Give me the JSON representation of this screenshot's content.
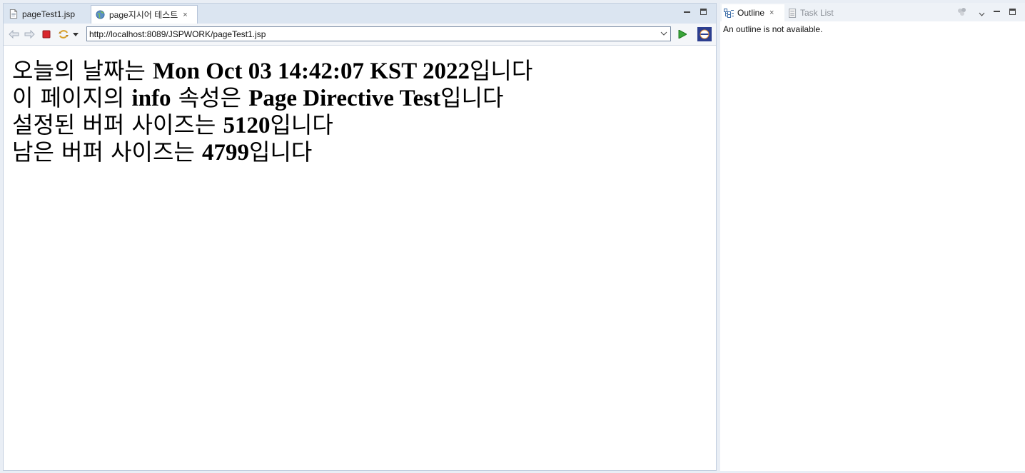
{
  "editor": {
    "tabs": [
      {
        "label": "pageTest1.jsp",
        "icon": "jsp-file-icon",
        "active": false
      },
      {
        "label": "page지시어 테스트",
        "icon": "globe-icon",
        "active": true,
        "close": "×"
      }
    ],
    "toolbar": {
      "url": "http://localhost:8089/JSPWORK/pageTest1.jsp"
    },
    "content": [
      {
        "prefix": "오늘의 날짜는 ",
        "value": "Mon Oct 03 14:42:07 KST 2022",
        "suffix": "입니다"
      },
      {
        "prefix": "이 페이지의 ",
        "value": "info",
        "middle": " 속성은 ",
        "value2": "Page Directive Test",
        "suffix": "입니다"
      },
      {
        "prefix": "설정된 버퍼 사이즈는 ",
        "value": "5120",
        "suffix": "입니다"
      },
      {
        "prefix": "남은 버퍼 사이즈는 ",
        "value": "4799",
        "suffix": "입니다"
      }
    ]
  },
  "side": {
    "tabs": [
      {
        "label": "Outline",
        "icon": "outline-icon",
        "active": true,
        "close": "×"
      },
      {
        "label": "Task List",
        "icon": "task-list-icon",
        "active": false
      }
    ],
    "message": "An outline is not available."
  },
  "colors": {
    "tab_bar": "#dbe5f1",
    "pane_border": "#c3cfdf",
    "stop_red": "#d9262c",
    "go_green": "#3aa53a"
  }
}
